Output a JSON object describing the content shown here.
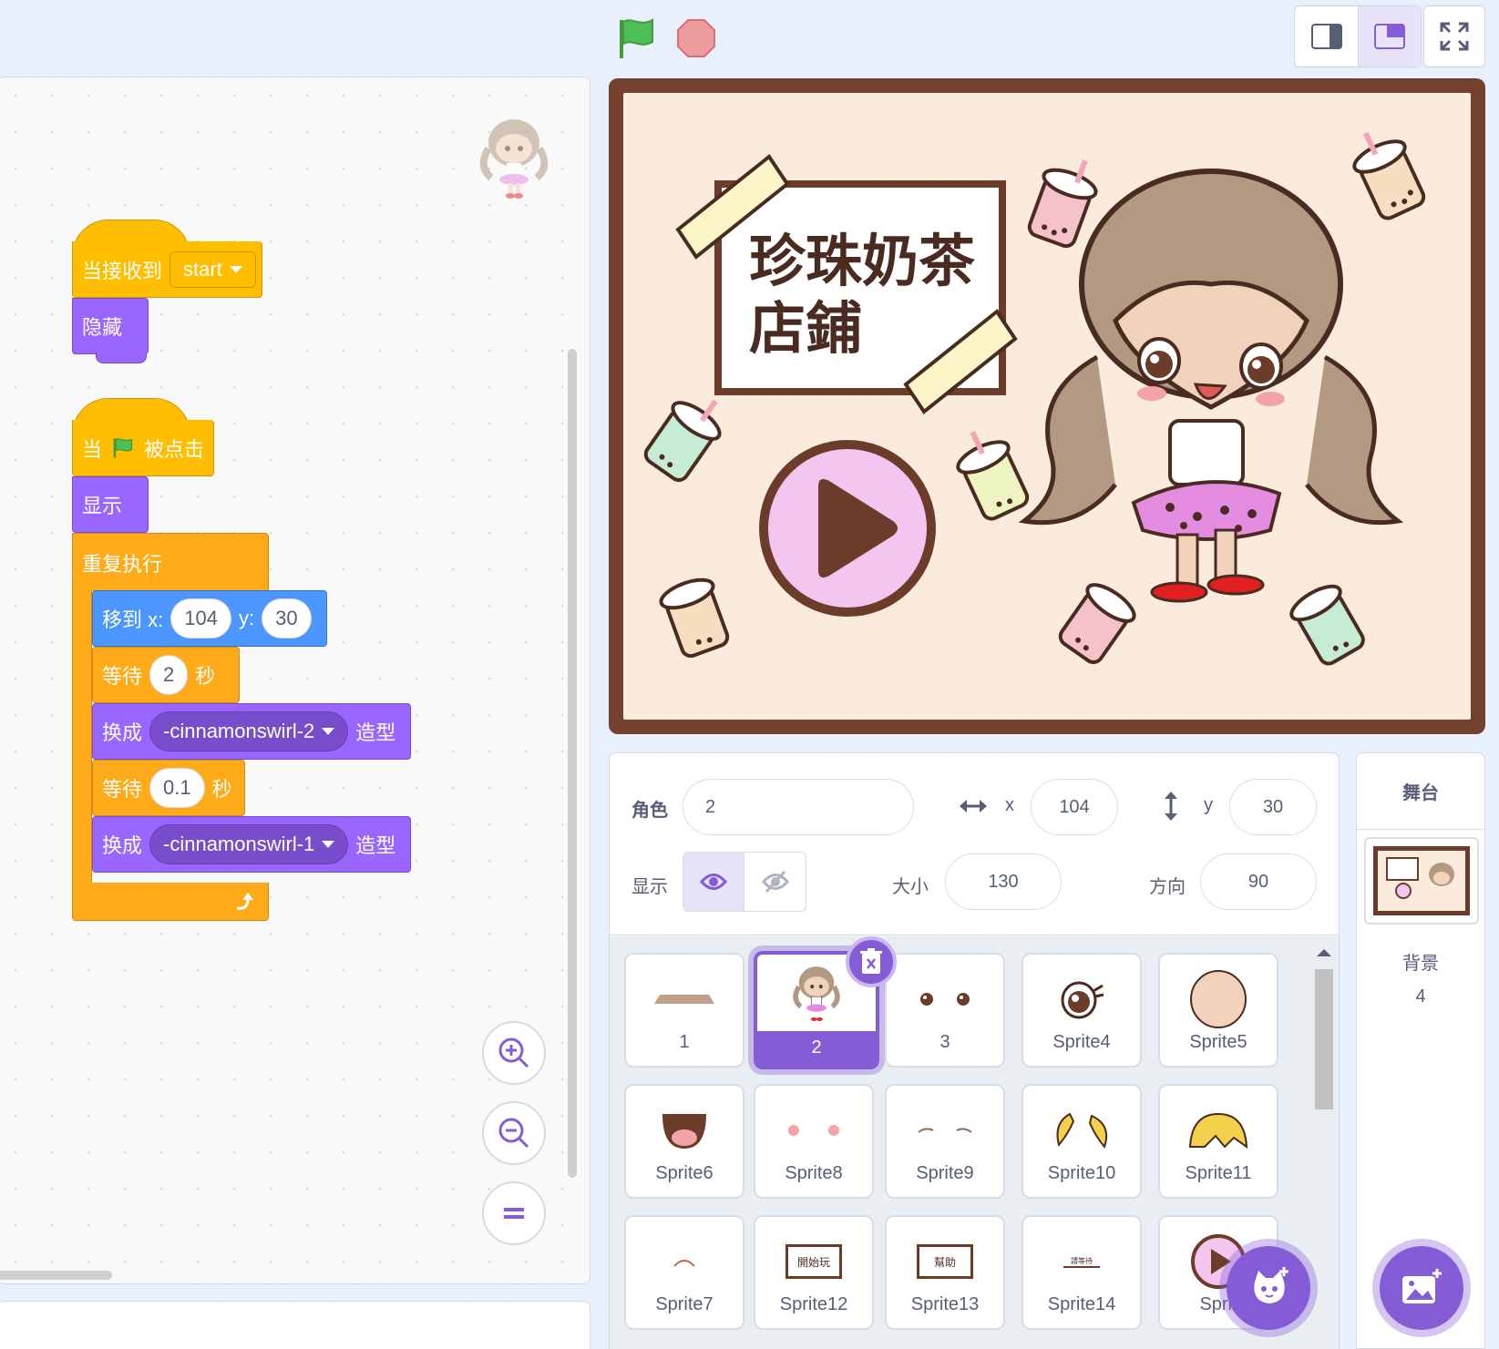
{
  "stage": {
    "title_line1": "珍珠奶茶",
    "title_line2": "店鋪"
  },
  "code": {
    "when_receive": "当接收到",
    "message": "start",
    "hide": "隐藏",
    "when_flag_prefix": "当",
    "when_flag_suffix": "被点击",
    "show": "显示",
    "forever": "重复执行",
    "goto_label": "移到 x:",
    "goto_x": "104",
    "goto_y_label": "y:",
    "goto_y": "30",
    "wait": "等待",
    "wait1_value": "2",
    "seconds": "秒",
    "switch": "换成",
    "costume1": "-cinnamonswirl-2",
    "costume_suffix": "造型",
    "wait2_value": "0.1",
    "costume2": "-cinnamonswirl-1"
  },
  "sprite_info": {
    "sprite_label": "角色",
    "sprite_name": "2",
    "x_label": "x",
    "x_value": "104",
    "y_label": "y",
    "y_value": "30",
    "show_label": "显示",
    "size_label": "大小",
    "size_value": "130",
    "direction_label": "方向",
    "direction_value": "90"
  },
  "sprites": [
    {
      "name": "1"
    },
    {
      "name": "2"
    },
    {
      "name": "3"
    },
    {
      "name": "Sprite4"
    },
    {
      "name": "Sprite5"
    },
    {
      "name": "Sprite6"
    },
    {
      "name": "Sprite8"
    },
    {
      "name": "Sprite9"
    },
    {
      "name": "Sprite10"
    },
    {
      "name": "Sprite11"
    },
    {
      "name": "Sprite7"
    },
    {
      "name": "Sprite12"
    },
    {
      "name": "Sprite13"
    },
    {
      "name": "Sprite14"
    },
    {
      "name": "Sprit"
    }
  ],
  "sprite_thumb_text": {
    "start": "開始玩",
    "help": "幫助",
    "wait": "請等待"
  },
  "stage_panel": {
    "header": "舞台",
    "backdrop_label": "背景",
    "backdrop_count": "4"
  },
  "colors": {
    "events": "#ffbf00",
    "looks": "#9966ff",
    "control": "#ffab19",
    "motion": "#4c97ff",
    "accent": "#855cd6"
  }
}
